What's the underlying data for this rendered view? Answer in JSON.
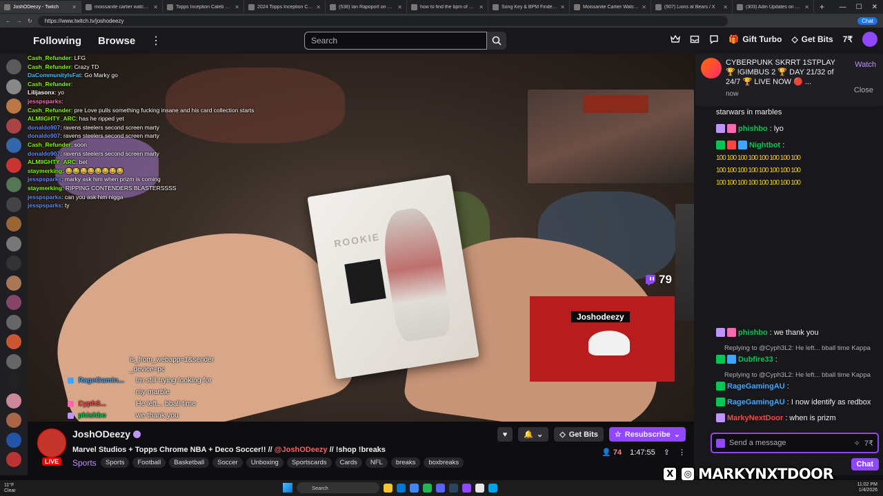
{
  "browser": {
    "tabs": [
      {
        "label": "JoshODeezy - Twitch",
        "active": true
      },
      {
        "label": "moissanite cartier watch rainbo..."
      },
      {
        "label": "Topps Inception Caleb Williams..."
      },
      {
        "label": "2024 Topps Inception Caleb Wi..."
      },
      {
        "label": "(538) Ian Rapoport on X: \"Vinta..."
      },
      {
        "label": "how to find the bpm of a song -..."
      },
      {
        "label": "Song Key & BPM Finder | Tunebat"
      },
      {
        "label": "Moissanite Cartier Watch - Custo..."
      },
      {
        "label": "(507) Lions at Bears / X"
      },
      {
        "label": "(303) Adin Updates on X: \"Adin ..."
      }
    ],
    "url": "https://www.twitch.tv/joshodeezy",
    "chrome_chat_label": "Chat"
  },
  "header": {
    "following": "Following",
    "browse": "Browse",
    "search_placeholder": "Search",
    "gift_turbo": "Gift Turbo",
    "get_bits": "Get Bits"
  },
  "overlay_chat": [
    {
      "user": "Cash_Refunder",
      "msg": "LFG",
      "color": "#7cfc00"
    },
    {
      "user": "Cash_Refunder",
      "msg": "Crazy TD",
      "color": "#7cfc00"
    },
    {
      "user": "DaCommunityIsFat",
      "msg": "Go Marky go",
      "color": "#3fc3ff"
    },
    {
      "user": "Cash_Refunder",
      "msg": "",
      "color": "#7cfc00"
    },
    {
      "user": "Lilijasonx",
      "msg": "yo",
      "color": "#ffffff"
    },
    {
      "user": "jesspsparks",
      "msg": "",
      "color": "#ff69b4"
    },
    {
      "user": "Cash_Refunder",
      "msg": "pre Love pulls something fucking insane and his card collection starts",
      "color": "#7cfc00"
    },
    {
      "user": "ALMIIGHTY_ARC",
      "msg": "has he ripped yet",
      "color": "#7cfc00"
    },
    {
      "user": "donaldo907",
      "msg": "ravens steelers second screen marty",
      "color": "#5b8cff"
    },
    {
      "user": "donaldo907",
      "msg": "ravens steelers second screen marty",
      "color": "#5b8cff"
    },
    {
      "user": "Cash_Refunder",
      "msg": "soon",
      "color": "#7cfc00"
    },
    {
      "user": "donaldo907",
      "msg": "ravens steelers second screen marty",
      "color": "#5b8cff"
    },
    {
      "user": "ALMIIGHTY_ARC",
      "msg": "bet",
      "color": "#7cfc00"
    },
    {
      "user": "staymerking",
      "msg": "😂😂😂😂😂😂😂😂",
      "color": "#7cfc00"
    },
    {
      "user": "jesspsparks",
      "msg": "marky ask him when prizm is coming",
      "color": "#5b8cff"
    },
    {
      "user": "staymerking",
      "msg": "RIPPING CONTENDERS BLASTERSSSS",
      "color": "#7cfc00"
    },
    {
      "user": "jesspsparks",
      "msg": "can you ask him nigga",
      "color": "#5b8cff"
    },
    {
      "user": "jesspsparks",
      "msg": "ty",
      "color": "#5b8cff"
    }
  ],
  "overlay_chat2": {
    "sender_line1": "is_from_webapp=1&sender",
    "sender_line2": "_device=pc",
    "rows": [
      {
        "user": "RageGamin...",
        "msg": "Im still trying looking for",
        "color": "#3fa5ff",
        "badge": "#3fa5ff"
      },
      {
        "user": "",
        "msg": "my marble",
        "color": "#3fa5ff",
        "badge": ""
      },
      {
        "user": "Cyph3...",
        "msg": "He left... bball time",
        "color": "#ff4444",
        "badge": "#ff69b4"
      },
      {
        "user": "phishbo",
        "msg": "we thank you",
        "color": "#00c853",
        "badge": "#bf94ff"
      },
      {
        "user": "Dubfire33",
        "msg": "@Cyph3L2",
        "color": "#ff4444",
        "badge": "#aaaaaa"
      },
      {
        "user": "RageGamin...",
        "msg": "@Cyph3L2",
        "color": "#3fa5ff",
        "badge": "#00c853"
      },
      {
        "user": "RageGamin...",
        "msg": "I now identify as redbox",
        "color": "#3fa5ff",
        "badge": "#00c853"
      },
      {
        "user": "MarkyNext...",
        "msg": "when is prizm",
        "color": "#ff4444",
        "badge": "#bf94ff"
      }
    ]
  },
  "video": {
    "viewer_badge": "79",
    "pip_name": "Joshodeezy"
  },
  "stream": {
    "channel": "JoshODeezy",
    "live": "LIVE",
    "title_pre": "Marvel Studios + Topps Chrome NBA + Deco Soccer!! // ",
    "title_mention": "@JoshODeezy",
    "title_post": " // !shop !breaks",
    "category": "Sports",
    "tags": [
      "Sports",
      "Football",
      "Basketball",
      "Soccer",
      "Unboxing",
      "Sportscards",
      "Cards",
      "NFL",
      "breaks",
      "boxbreaks"
    ],
    "get_bits": "Get Bits",
    "resubscribe": "Resubscribe",
    "viewers": "74",
    "uptime": "1:47:55"
  },
  "chat": {
    "notif_text": "CYBERPUNK SKRRT 1STPLAY 🏆 !GIMBUS 2 🏆 DAY 21/32 of 24/7 🏆 LIVE NOW 🔴 ...",
    "notif_time": "now",
    "notif_watch": "Watch",
    "notif_close": "Close",
    "line_top": "starwars in marbles",
    "messages": [
      {
        "user": "phishbo",
        "msg": "lyo",
        "color": "#00c853"
      },
      {
        "user": "Nightbot",
        "msg": "",
        "color": "#00c853"
      },
      {
        "user": "phishbo",
        "msg": "we thank you",
        "color": "#00c853"
      },
      {
        "user": "Dubfire33",
        "msg": "",
        "color": "#00c853"
      },
      {
        "user": "RageGamingAU",
        "msg": "",
        "color": "#3fa5ff"
      },
      {
        "user": "RageGamingAU",
        "msg": "I now identify as redbox",
        "color": "#3fa5ff"
      },
      {
        "user": "MarkyNextDoor",
        "msg": "when is prizm",
        "color": "#ff4444"
      }
    ],
    "emote_line": "100 100 100 100 100 100 100 100",
    "reply1": "Replying to @Cyph3L2: He left... bball time Kappa",
    "reply2": "Replying to @Cyph3L2: He left... bball time Kappa",
    "input_placeholder": "Send a message",
    "chat_btn": "Chat",
    "watermark": "MARKYNXTDOOR"
  },
  "taskbar": {
    "weather_temp": "11°F",
    "weather_desc": "Clear",
    "search": "Search",
    "time": "11:02 PM",
    "date": "1/4/2026"
  }
}
